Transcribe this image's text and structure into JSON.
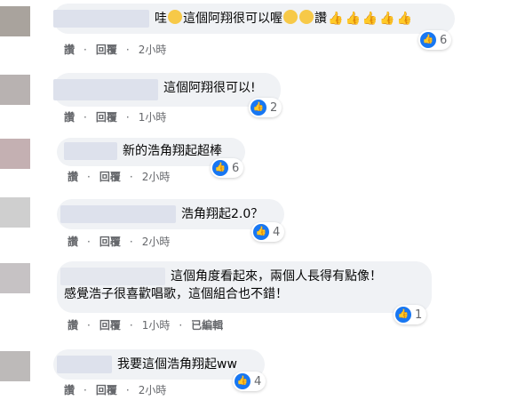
{
  "comments": [
    {
      "text": "哇",
      "text2": "這個阿翔很可以喔",
      "text3": "讚",
      "reactions": "6",
      "actions": {
        "like": "讚",
        "reply": "回覆",
        "time": "2小時"
      }
    },
    {
      "text": "這個阿翔很可以!",
      "reactions": "2",
      "actions": {
        "like": "讚",
        "reply": "回覆",
        "time": "1小時"
      }
    },
    {
      "text": "新的浩角翔起超棒",
      "reactions": "6",
      "actions": {
        "like": "讚",
        "reply": "回覆",
        "time": "2小時"
      }
    },
    {
      "text": "浩角翔起2.0？",
      "reactions": "4",
      "actions": {
        "like": "讚",
        "reply": "回覆",
        "time": "2小時"
      }
    },
    {
      "text": "這個角度看起來，兩個人長得有點像！",
      "text2": "感覺浩子很喜歡唱歌，這個組合也不錯！",
      "reactions": "1",
      "actions": {
        "like": "讚",
        "reply": "回覆",
        "time": "1小時",
        "edited": "已編輯"
      }
    },
    {
      "text": "我要這個浩角翔起ww",
      "reactions": "4",
      "actions": {
        "like": "讚",
        "reply": "回覆",
        "time": "2小時"
      }
    }
  ],
  "icons": {
    "like": "thumbs-up-icon"
  },
  "colors": {
    "like_blue": "#1877f2",
    "bubble": "#f0f2f5",
    "meta": "#65676b"
  }
}
